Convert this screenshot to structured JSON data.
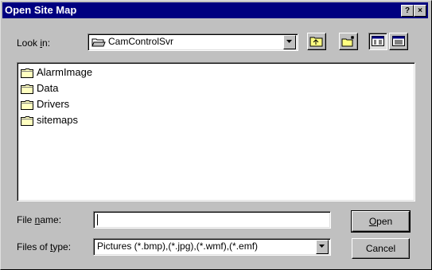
{
  "window": {
    "title": "Open Site Map"
  },
  "titlebar": {
    "help_label": "?",
    "close_label": "×"
  },
  "look_in": {
    "label_prefix": "Look ",
    "label_accel": "i",
    "label_suffix": "n:",
    "value": "CamControlSvr"
  },
  "files": [
    {
      "name": "AlarmImage",
      "type": "folder"
    },
    {
      "name": "Data",
      "type": "folder"
    },
    {
      "name": "Drivers",
      "type": "folder"
    },
    {
      "name": "sitemaps",
      "type": "folder"
    }
  ],
  "file_name": {
    "label_prefix": "File ",
    "label_accel": "n",
    "label_suffix": "ame:",
    "value": ""
  },
  "file_type": {
    "label_prefix": "Files of ",
    "label_accel": "t",
    "label_suffix": "ype:",
    "value": "Pictures (*.bmp),(*.jpg),(*.wmf),(*.emf)"
  },
  "buttons": {
    "open_accel": "O",
    "open_rest": "pen",
    "cancel": "Cancel"
  },
  "icons": {
    "toolbar": [
      "up-one-level-icon",
      "create-new-folder-icon",
      "list-view-icon",
      "details-view-icon"
    ]
  }
}
